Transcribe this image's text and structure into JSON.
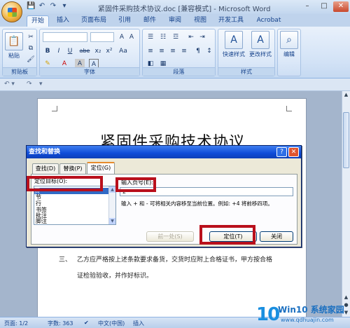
{
  "window": {
    "title": "紧固件采购技术协议.doc [兼容模式] - Microsoft Word",
    "qat": [
      "💾",
      "↶",
      "↷",
      "▾"
    ],
    "controls": [
      "–",
      "□",
      "✕"
    ]
  },
  "ribbon": {
    "tabs": [
      "开始",
      "插入",
      "页面布局",
      "引用",
      "邮件",
      "审阅",
      "视图",
      "开发工具",
      "Acrobat"
    ],
    "groups": {
      "clipboard": "剪贴板",
      "font": "字体",
      "paragraph": "段落",
      "styles": "样式",
      "editing": "编辑"
    },
    "paste_label": "粘贴",
    "quick_styles_label": "快速样式",
    "change_styles_label": "更改样式",
    "editing_label": "编辑",
    "font_buttons": [
      "B",
      "I",
      "U",
      "abe",
      "x₂",
      "x²",
      "Aa",
      "A",
      "A",
      "A"
    ],
    "paragraph_symbols": [
      "≡",
      "≡",
      "≡",
      "≡",
      "¶",
      "↕",
      "⇥"
    ]
  },
  "subbar": {
    "items": [
      "↶ ▾",
      "↷",
      "▾"
    ]
  },
  "document": {
    "title": "紧固件采购技术协议",
    "line1_num": "三、",
    "line1": "乙方应严格按上述条款要求备货，交货时应附上合格证书，甲方按合格",
    "line2": "证检验验收，并作好标识。"
  },
  "dialog": {
    "title": "查找和替换",
    "help": "?",
    "close": "✕",
    "tabs": [
      "查找(D)",
      "替换(P)",
      "定位(G)"
    ],
    "target_label": "定位目标(O):",
    "targets": [
      "页",
      "节",
      "行",
      "书签",
      "批注",
      "脚注"
    ],
    "input_label": "输入页号(E):",
    "input_value": "2",
    "hint": "输入 + 和 - 可将相关内容移至当前位置。例如: +4 将前移四项。",
    "prev_button": "前一处(S)",
    "goto_button": "定位(T)",
    "close_button": "关闭"
  },
  "statusbar": {
    "page": "页面: 1/2",
    "words": "字数: 363",
    "check": "✔",
    "lang": "中文(中国)",
    "mode": "插入"
  },
  "watermark": {
    "number": "10",
    "brand": "Win10 系统家园",
    "url": "www.qdhuajin.com"
  },
  "colors": {
    "highlight": "#b9101c",
    "dialog_title": "#0f4cd8",
    "ribbon": "#d2e2f6"
  }
}
